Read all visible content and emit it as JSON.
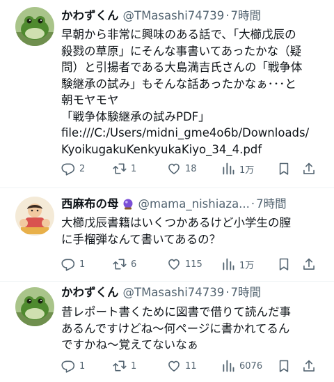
{
  "tweets": [
    {
      "name": "かわずくん",
      "handle": "@TMasashi74739",
      "sep": "·",
      "time": "7時間",
      "lines": [
        "早朝から非常に興味のある話で、「大櫛戊辰の",
        "殺戮の草原」にそんな事書いてあったかな（疑",
        "問）と引揚者である大島満吉氏さんの「戦争体",
        "験継承の試み」もそんな話あったかなぁ･･･と",
        "朝モヤモヤ",
        "「戦争体験継承の試みPDF」",
        "file:///C:/Users/midni_gme4o6b/Downloads/",
        "KyoikugakuKenkyukaKiyo_34_4.pdf"
      ],
      "replies": "2",
      "retweets": "1",
      "likes": "18",
      "views": "1万"
    },
    {
      "name": "西麻布の母",
      "handle": "@mama_nishiaza...",
      "sep": "·",
      "time": "7時間",
      "lines": [
        "大櫛戊辰書籍はいくつかあるけど小学生の膣",
        "に手榴弾なんて書いてあるの？"
      ],
      "replies": "1",
      "retweets": "6",
      "likes": "115",
      "views": "1万"
    },
    {
      "name": "かわずくん",
      "handle": "@TMasashi74739",
      "sep": "·",
      "time": "7時間",
      "lines": [
        "昔レポート書くために図書で借りて読んだ事",
        "あるんですけどね〜何ページに書かれてるん",
        "ですかね〜覚えてないなぁ"
      ],
      "replies": "1",
      "retweets": "1",
      "likes": "11",
      "views": "6076"
    }
  ],
  "colors": {
    "text": "#0f1419",
    "muted": "#536471",
    "divider": "#eff3f4",
    "badge": "#7b4fd6"
  },
  "icons": [
    "reply-icon",
    "retweet-icon",
    "like-icon",
    "views-icon",
    "bookmark-icon",
    "share-icon"
  ]
}
